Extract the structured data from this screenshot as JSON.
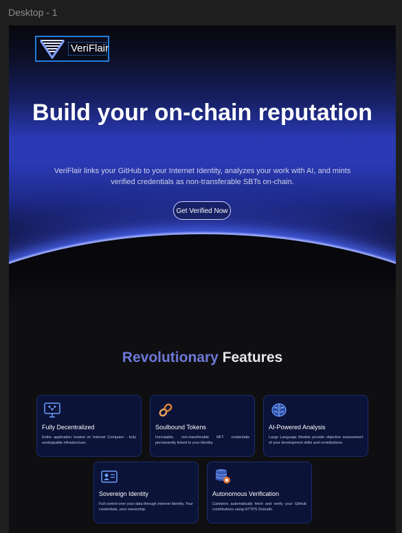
{
  "frame_label": "Desktop - 1",
  "brand": {
    "name": "VeriFlair"
  },
  "hero": {
    "title": "Build your on-chain reputation",
    "subtitle": "VeriFlair links your GitHub to your Internet Identity, analyzes your work with AI, and mints verified credentials as non-transferable SBTs on-chain.",
    "cta": "Get Verified Now"
  },
  "features": {
    "title_accent": "Revolutionary",
    "title_rest": " Features",
    "items": [
      {
        "title": "Fully Decentralized",
        "description": "Entire application hosted on Internet Computer - truly unstoppable infrastructure.",
        "icon": "network-icon"
      },
      {
        "title": "Soulbound Tokens",
        "description": "Immutable, non-transferable NFT credentials permanently linked to your identity.",
        "icon": "chain-link-icon"
      },
      {
        "title": "AI-Powered Analysis",
        "description": "Large Language Models provide objective assessment of your development skills and contributions.",
        "icon": "brain-icon"
      },
      {
        "title": "Sovereign Identity",
        "description": "Full control over your data through Internet Identity. Your credentials, your ownership.",
        "icon": "id-card-icon"
      },
      {
        "title": "Autonomous Verification",
        "description": "Canisters automatically fetch and verify your GitHub contributions using HTTPS Outcalls.",
        "icon": "database-icon"
      }
    ]
  },
  "colors": {
    "accent": "#6d79d6",
    "brand_blue": "#1f7fe0",
    "hero_blue": "#2a3ab5",
    "card_bg": "#0b1338"
  }
}
